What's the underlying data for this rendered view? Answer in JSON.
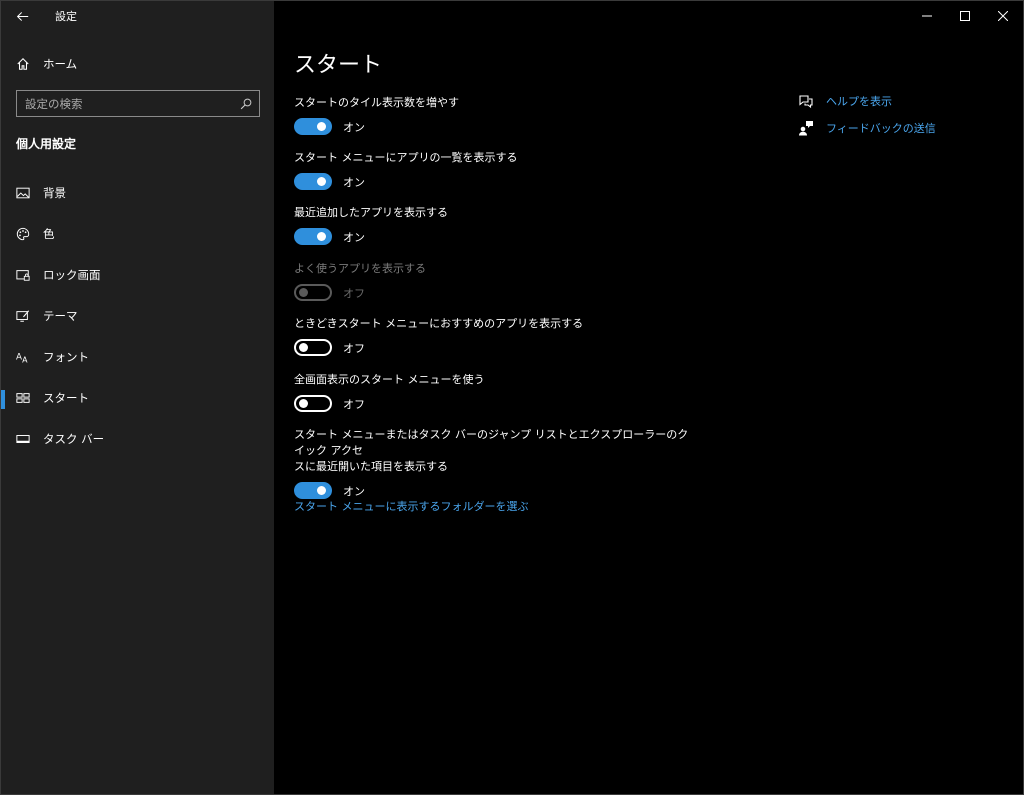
{
  "app": {
    "title": "設定"
  },
  "sidebar": {
    "home_label": "ホーム",
    "search_placeholder": "設定の検索",
    "section_title": "個人用設定",
    "items": [
      {
        "label": "背景",
        "icon": "picture-icon"
      },
      {
        "label": "色",
        "icon": "palette-icon"
      },
      {
        "label": "ロック画面",
        "icon": "lock-screen-icon"
      },
      {
        "label": "テーマ",
        "icon": "theme-icon"
      },
      {
        "label": "フォント",
        "icon": "font-icon"
      },
      {
        "label": "スタート",
        "icon": "start-icon",
        "active": true
      },
      {
        "label": "タスク バー",
        "icon": "taskbar-icon"
      }
    ]
  },
  "main": {
    "page_title": "スタート",
    "settings": [
      {
        "label": "スタートのタイル表示数を増やす",
        "state": "オン"
      },
      {
        "label": "スタート メニューにアプリの一覧を表示する",
        "state": "オン"
      },
      {
        "label": "最近追加したアプリを表示する",
        "state": "オン"
      },
      {
        "label": "よく使うアプリを表示する",
        "state": "オフ"
      },
      {
        "label": "ときどきスタート メニューにおすすめのアプリを表示する",
        "state": "オフ"
      },
      {
        "label": "全画面表示のスタート メニューを使う",
        "state": "オフ"
      },
      {
        "label_line1": "スタート メニューまたはタスク バーのジャンプ リストとエクスプローラーのクイック アクセ",
        "label_line2": "スに最近開いた項目を表示する",
        "state": "オン"
      }
    ],
    "folder_link": "スタート メニューに表示するフォルダーを選ぶ"
  },
  "help": {
    "show_help": "ヘルプを表示",
    "send_feedback": "フィードバックの送信"
  },
  "colors": {
    "accent": "#2f8fdc",
    "link": "#4aa5ec",
    "sidebar_bg": "#1f1f1f",
    "main_bg": "#000000"
  }
}
